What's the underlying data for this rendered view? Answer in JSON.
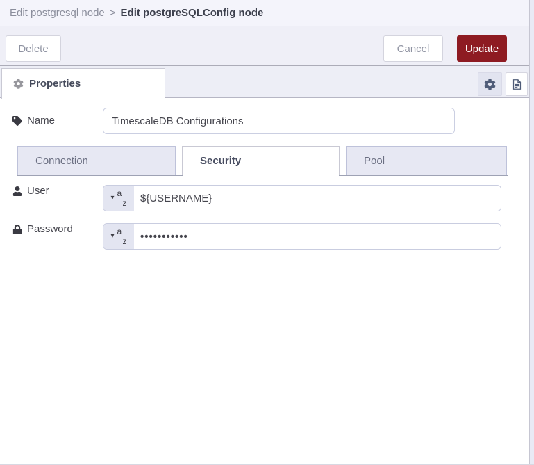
{
  "breadcrumb": {
    "parent": "Edit postgresql node",
    "separator": ">",
    "current": "Edit postgreSQLConfig node"
  },
  "toolbar": {
    "delete_label": "Delete",
    "cancel_label": "Cancel",
    "update_label": "Update"
  },
  "properties_panel": {
    "tab_label": "Properties",
    "icons": [
      "gear-icon",
      "gear-button-icon",
      "document-button-icon"
    ]
  },
  "fields": {
    "name": {
      "label": "Name",
      "value": "TimescaleDB Configurations",
      "icon": "tag-icon"
    },
    "user": {
      "label": "User",
      "value": "${USERNAME}",
      "icon": "user-icon",
      "type": "string"
    },
    "password": {
      "label": "Password",
      "value": "•••••••••••",
      "icon": "lock-icon",
      "type": "string"
    }
  },
  "typed_input": {
    "caret": "▾",
    "letter_top": "a",
    "letter_bottom": "z"
  },
  "tabs": [
    {
      "label": "Connection",
      "active": false
    },
    {
      "label": "Security",
      "active": true
    },
    {
      "label": "Pool",
      "active": false
    }
  ],
  "colors": {
    "update_button_bg": "#8E1B22",
    "header_bg": "#F4F4FB",
    "toolbar_bg": "#EFEFF7",
    "inactive_tab_bg": "#E7E8F3",
    "typed_button_bg": "#E3E5F1"
  }
}
